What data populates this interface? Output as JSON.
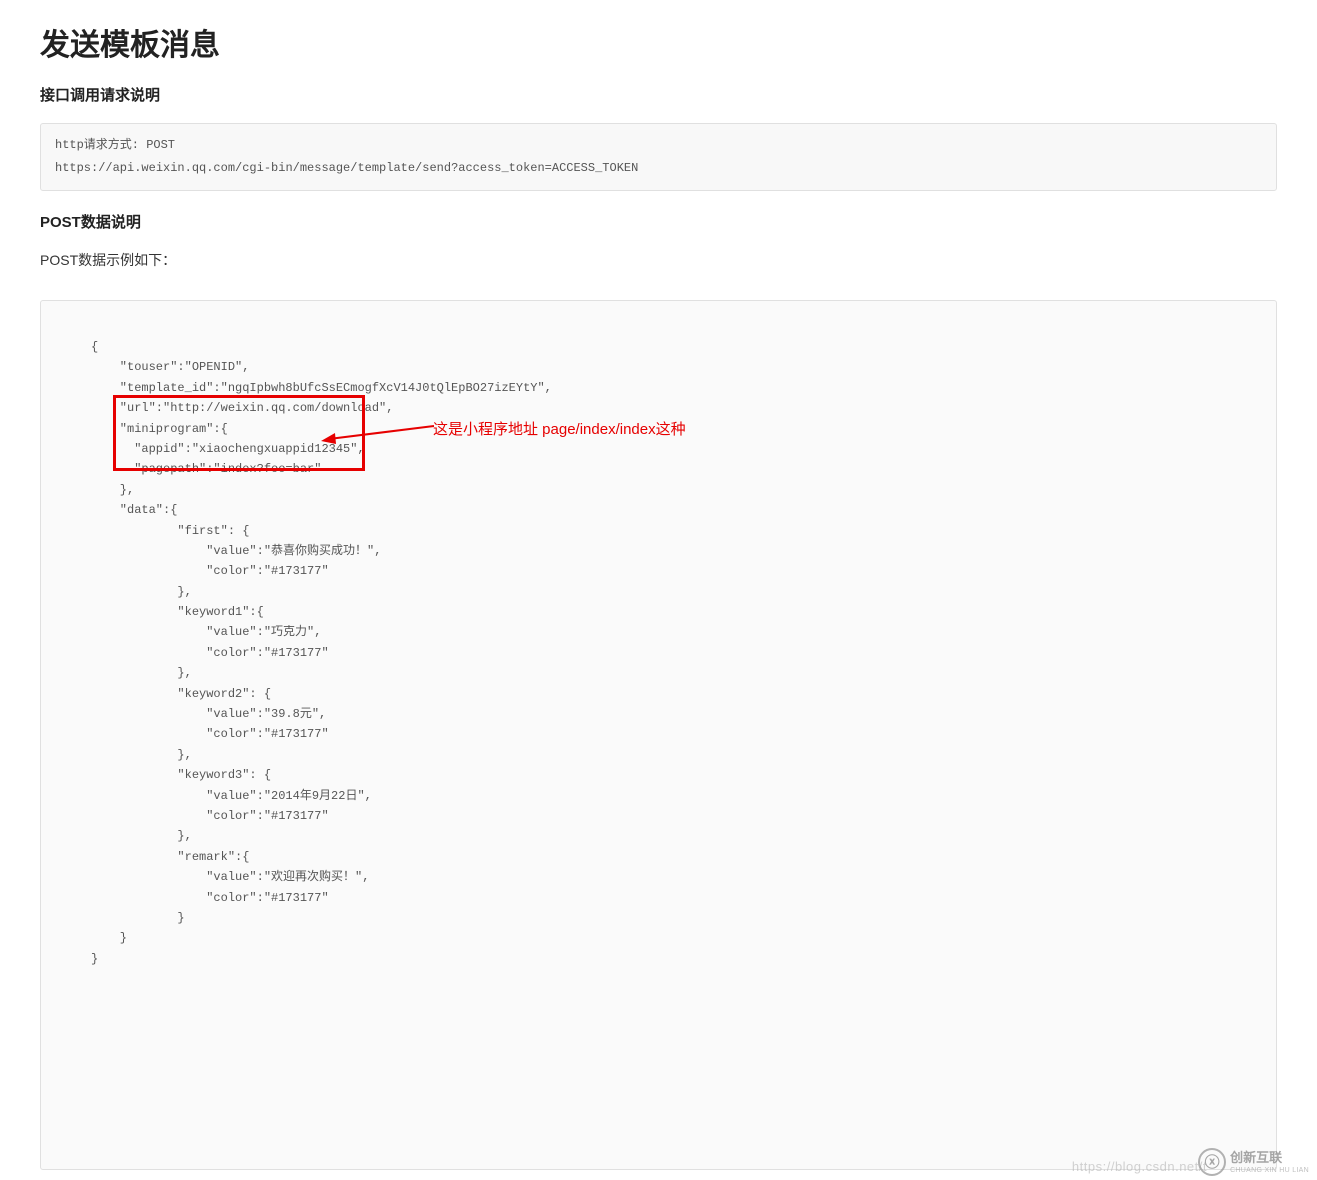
{
  "page": {
    "title": "发送模板消息",
    "subtitle1": "接口调用请求说明",
    "api_box": "http请求方式: POST\nhttps://api.weixin.qq.com/cgi-bin/message/template/send?access_token=ACCESS_TOKEN",
    "subtitle2": "POST数据说明",
    "example_intro": "POST数据示例如下："
  },
  "json_example": {
    "pre_highlight": "{\n    \"touser\":\"OPENID\",\n    \"template_id\":\"ngqIpbwh8bUfcSsECmogfXcV14J0tQlEpBO27izEYtY\",\n    \"url\":\"http://weixin.qq.com/download\",",
    "highlighted": "    \"miniprogram\":{\n      \"appid\":\"xiaochengxuappid12345\",\n      \"pagepath\":\"index?foo=bar\"\n    },",
    "post_highlight": "    \"data\":{\n            \"first\": {\n                \"value\":\"恭喜你购买成功！\",\n                \"color\":\"#173177\"\n            },\n            \"keyword1\":{\n                \"value\":\"巧克力\",\n                \"color\":\"#173177\"\n            },\n            \"keyword2\": {\n                \"value\":\"39.8元\",\n                \"color\":\"#173177\"\n            },\n            \"keyword3\": {\n                \"value\":\"2014年9月22日\",\n                \"color\":\"#173177\"\n            },\n            \"remark\":{\n                \"value\":\"欢迎再次购买！\",\n                \"color\":\"#173177\"\n            }\n    }\n}"
  },
  "annotation": {
    "text": "这是小程序地址 page/index/index这种"
  },
  "watermark": {
    "url": "https://blog.csdn.net/t",
    "logo_glyph": "ⓧ",
    "logo_text": "创新互联",
    "logo_sub": "CHUANG XIN HU LIAN"
  }
}
